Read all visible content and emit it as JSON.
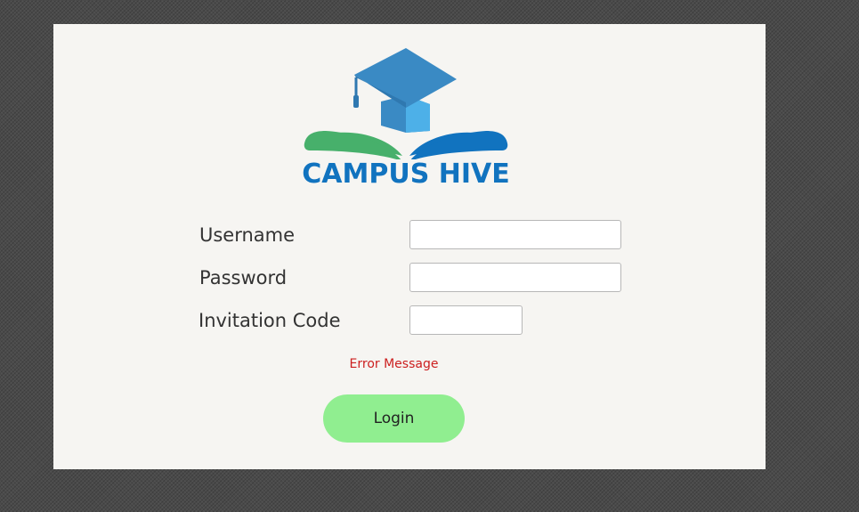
{
  "logo": {
    "name": "CAMPUS HIVE",
    "icon": "graduation-cap-book-icon",
    "colors": {
      "cap": "#3a8ac4",
      "cap_side": "#4db0e8",
      "book_left": "#47b06b",
      "book_right": "#1173bf",
      "text": "#1173bf"
    }
  },
  "form": {
    "username_label": "Username",
    "username_value": "",
    "password_label": "Password",
    "password_value": "",
    "invitation_label": "Invitation Code",
    "invitation_value": ""
  },
  "error_message": "Error Message",
  "login_label": "Login",
  "colors": {
    "background": "#4a4a4a",
    "panel": "#f6f5f2",
    "error": "#cc1f1f",
    "login_button": "#90ee90"
  }
}
